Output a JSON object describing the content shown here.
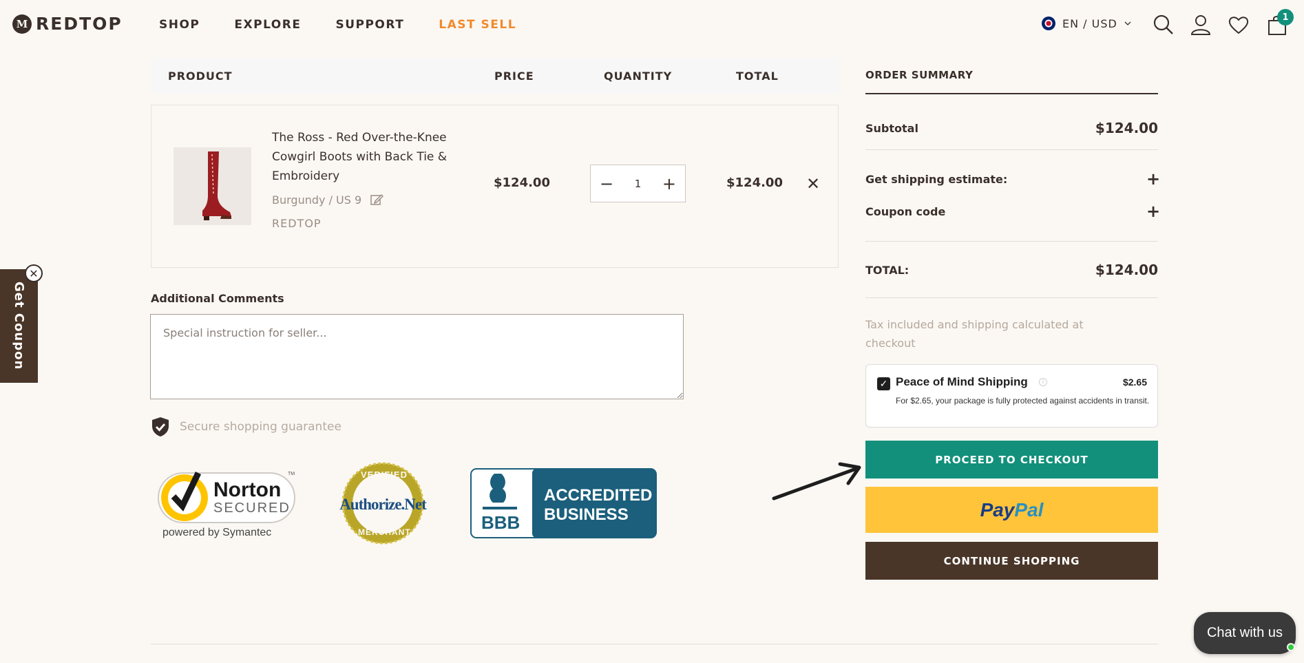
{
  "brand": {
    "logo_text": "REDTOP",
    "logo_mark": "M"
  },
  "nav": {
    "items": [
      "SHOP",
      "EXPLORE",
      "SUPPORT",
      "LAST SELL"
    ]
  },
  "header": {
    "locale": "EN / USD",
    "cart_count": "1",
    "icons": [
      "flag-uk-icon",
      "chevron-down-icon",
      "search-icon",
      "account-icon",
      "wishlist-heart-icon",
      "cart-bag-icon"
    ]
  },
  "cart": {
    "columns": {
      "product": "PRODUCT",
      "price": "PRICE",
      "quantity": "QUANTITY",
      "total": "TOTAL"
    },
    "item": {
      "name": "The Ross - Red Over-the-Knee Cowgirl Boots with Back Tie & Embroidery",
      "variant": "Burgundy / US 9",
      "vendor": "REDTOP",
      "price": "$124.00",
      "quantity": "1",
      "total": "$124.00",
      "minus": "−",
      "plus": "+",
      "remove": "✕"
    }
  },
  "comments": {
    "label": "Additional Comments",
    "placeholder": "Special instruction for seller..."
  },
  "secure": {
    "text": "Secure shopping guarantee"
  },
  "badges": {
    "norton": {
      "top": "Norton",
      "middle": "SECURED",
      "bottom": "powered by Symantec",
      "tm": "TM"
    },
    "authorize": {
      "arc_top": "VERIFIED",
      "center": "Authorize.Net",
      "arc_bottom": "MERCHANT"
    },
    "bbb": {
      "line1": "ACCREDITED",
      "line2": "BUSINESS",
      "mark": "BBB"
    }
  },
  "summary": {
    "title": "ORDER SUMMARY",
    "subtotal_label": "Subtotal",
    "subtotal_value": "$124.00",
    "shipping_label": "Get shipping estimate:",
    "coupon_label": "Coupon code",
    "toggle": "+",
    "total_label": "TOTAL:",
    "total_value": "$124.00",
    "tax_note": "Tax included and shipping calculated at checkout"
  },
  "peace_of_mind": {
    "title": "Peace of Mind Shipping",
    "price": "$2.65",
    "description": "For $2.65, your package is fully protected against accidents in transit.",
    "check": "✓",
    "info": "i"
  },
  "buttons": {
    "checkout": "PROCEED TO CHECKOUT",
    "paypal_part1": "Pay",
    "paypal_part2": "Pal",
    "continue": "CONTINUE SHOPPING"
  },
  "coupon_tab": {
    "label": "Get Coupon",
    "close": "✕"
  },
  "chat": {
    "label": "Chat with us"
  },
  "colors": {
    "accent_green": "#12907b",
    "brown": "#4a3628",
    "orange": "#f08a2c",
    "paypal_yellow": "#ffc43a"
  }
}
